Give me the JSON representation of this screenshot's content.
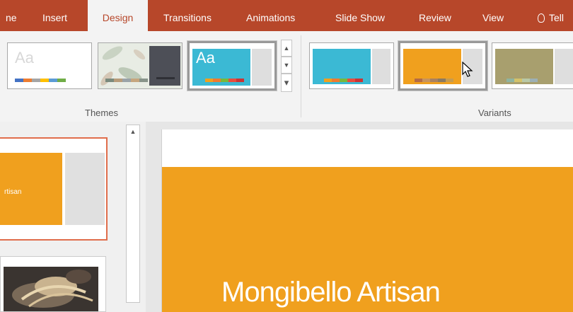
{
  "ribbon": {
    "tabs": [
      {
        "label": "ne",
        "active": false
      },
      {
        "label": "Insert",
        "active": false
      },
      {
        "label": "Design",
        "active": true
      },
      {
        "label": "Transitions",
        "active": false
      },
      {
        "label": "Animations",
        "active": false
      },
      {
        "label": "Slide Show",
        "active": false
      },
      {
        "label": "Review",
        "active": false
      },
      {
        "label": "View",
        "active": false
      },
      {
        "label": "Tell",
        "active": false,
        "icon": "lightbulb-icon"
      }
    ],
    "themes_label": "Themes",
    "variants_label": "Variants",
    "theme_aa": "Aa",
    "scroll_up": "▲",
    "scroll_down": "▼",
    "scroll_more": "▾"
  },
  "colors": {
    "accent": "#b7472a",
    "selected_border": "#e06d4b",
    "slide_orange": "#f0a01e",
    "variant_teal": "#3bb9d4",
    "variant_olive": "#a89f6e"
  },
  "slides_pane": {
    "thumb_text": "rtisan"
  },
  "slide": {
    "title": "Mongibello Artisan"
  }
}
